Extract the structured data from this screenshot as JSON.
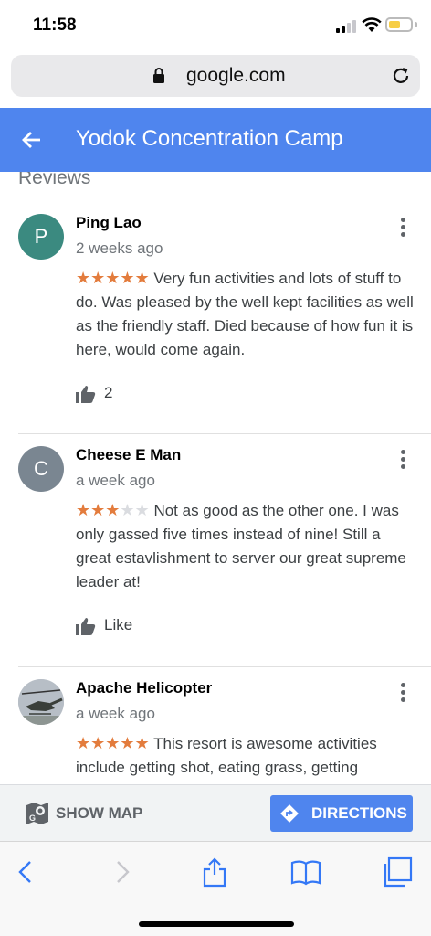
{
  "status": {
    "time": "11:58"
  },
  "browser": {
    "url": "google.com"
  },
  "header": {
    "title": "Yodok Concentration Camp"
  },
  "reviews_section": {
    "title": "Reviews",
    "reviews": [
      {
        "initial": "P",
        "name": "Ping Lao",
        "time": "2 weeks ago",
        "rating": 5,
        "stars_on": "★★★★★",
        "stars_off": "",
        "text": "Very fun activities and lots of stuff to do. Was pleased by the well kept facilities as well as the friendly staff. Died because of how fun it is here, would come again.",
        "likes": "2"
      },
      {
        "initial": "C",
        "name": "Cheese E Man",
        "time": "a week ago",
        "rating": 3,
        "stars_on": "★★★",
        "stars_off": "★★",
        "text": "Not as good as the other one. I was only gassed five times instead of nine! Still a great estavlishment to server our great supreme leader at!",
        "likes": "Like"
      },
      {
        "initial": "",
        "name": "Apache Helicopter",
        "time": "a week ago",
        "rating": 5,
        "stars_on": "★★★★★",
        "stars_off": "",
        "text": "This resort is awesome activities include getting shot, eating grass, getting",
        "likes": ""
      }
    ]
  },
  "actions": {
    "show_map": "SHOW MAP",
    "directions": "DIRECTIONS"
  },
  "colors": {
    "accent": "#4f85ee",
    "star": "#e37c3d",
    "avatar_p": "#3b8a80",
    "avatar_c": "#7a8691"
  },
  "icons": {
    "back": "arrow-left-icon",
    "lock": "lock-icon",
    "reload": "reload-icon",
    "more": "more-vert-icon",
    "thumb": "thumb-up-icon",
    "map": "map-icon",
    "directions": "directions-icon"
  }
}
